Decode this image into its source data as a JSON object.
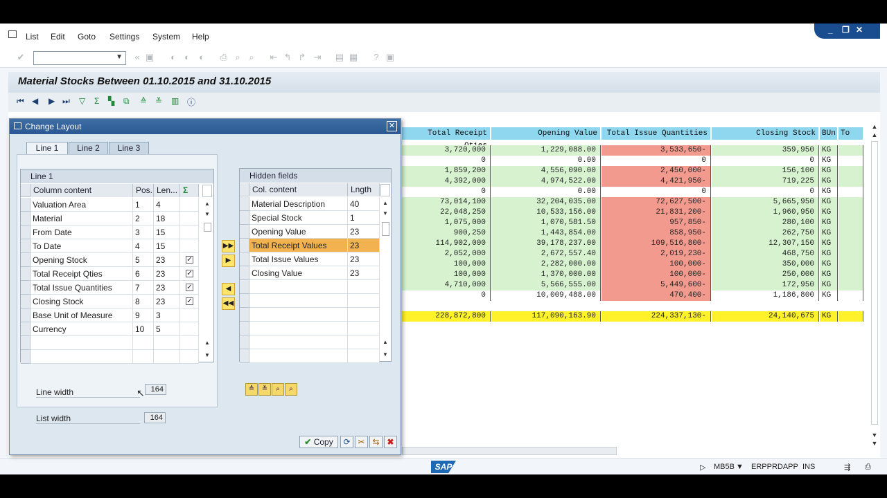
{
  "menu": [
    "List",
    "Edit",
    "Goto",
    "Settings",
    "System",
    "Help"
  ],
  "window_controls": [
    "_",
    "❐",
    "✕"
  ],
  "report": {
    "title": "Material Stocks Between 01.10.2015 and 31.10.2015",
    "headers": [
      "Total Receipt Qties",
      "Opening Value",
      "Total Issue Quantities",
      "Closing Stock",
      "BUn",
      "To"
    ],
    "rows": [
      {
        "receipt": "3,720,000",
        "opening": "1,229,088.00",
        "issue": "3,533,650-",
        "closing": "359,950",
        "bun": "KG",
        "style": "g"
      },
      {
        "receipt": "0",
        "opening": "0.00",
        "issue": "0",
        "closing": "0",
        "bun": "KG",
        "style": "w"
      },
      {
        "receipt": "1,859,200",
        "opening": "4,556,090.00",
        "issue": "2,450,000-",
        "closing": "156,100",
        "bun": "KG",
        "style": "g"
      },
      {
        "receipt": "4,392,000",
        "opening": "4,974,522.00",
        "issue": "4,421,950-",
        "closing": "719,225",
        "bun": "KG",
        "style": "g"
      },
      {
        "receipt": "0",
        "opening": "0.00",
        "issue": "0",
        "closing": "0",
        "bun": "KG",
        "style": "w"
      },
      {
        "receipt": "73,014,100",
        "opening": "32,204,035.00",
        "issue": "72,627,500-",
        "closing": "5,665,950",
        "bun": "KG",
        "style": "g"
      },
      {
        "receipt": "22,048,250",
        "opening": "10,533,156.00",
        "issue": "21,831,200-",
        "closing": "1,960,950",
        "bun": "KG",
        "style": "g"
      },
      {
        "receipt": "1,075,000",
        "opening": "1,070,581.50",
        "issue": "957,850-",
        "closing": "280,100",
        "bun": "KG",
        "style": "g"
      },
      {
        "receipt": "900,250",
        "opening": "1,443,854.00",
        "issue": "858,950-",
        "closing": "262,750",
        "bun": "KG",
        "style": "g"
      },
      {
        "receipt": "114,902,000",
        "opening": "39,178,237.00",
        "issue": "109,516,800-",
        "closing": "12,307,150",
        "bun": "KG",
        "style": "g"
      },
      {
        "receipt": "2,052,000",
        "opening": "2,672,557.40",
        "issue": "2,019,230-",
        "closing": "468,750",
        "bun": "KG",
        "style": "g"
      },
      {
        "receipt": "100,000",
        "opening": "2,282,000.00",
        "issue": "100,000-",
        "closing": "350,000",
        "bun": "KG",
        "style": "g"
      },
      {
        "receipt": "100,000",
        "opening": "1,370,000.00",
        "issue": "100,000-",
        "closing": "250,000",
        "bun": "KG",
        "style": "g"
      },
      {
        "receipt": "4,710,000",
        "opening": "5,566,555.00",
        "issue": "5,449,600-",
        "closing": "172,950",
        "bun": "KG",
        "style": "g"
      },
      {
        "receipt": "0",
        "opening": "10,009,488.00",
        "issue": "470,400-",
        "closing": "1,186,800",
        "bun": "KG",
        "style": "w"
      }
    ],
    "total": {
      "receipt": "228,872,800",
      "opening": "117,090,163.90",
      "issue": "224,337,130-",
      "closing": "24,140,675",
      "bun": "KG"
    }
  },
  "dialog": {
    "title": "Change Layout",
    "tabs": [
      "Line 1",
      "Line 2",
      "Line 3"
    ],
    "left_table": {
      "title": "Line 1",
      "headers": [
        "Column content",
        "Pos.",
        "Len..."
      ],
      "rows": [
        {
          "content": "Valuation Area",
          "pos": "1",
          "len": "4",
          "sum": false
        },
        {
          "content": "Material",
          "pos": "2",
          "len": "18",
          "sum": false
        },
        {
          "content": "From Date",
          "pos": "3",
          "len": "15",
          "sum": false
        },
        {
          "content": "To Date",
          "pos": "4",
          "len": "15",
          "sum": false
        },
        {
          "content": "Opening Stock",
          "pos": "5",
          "len": "23",
          "sum": true
        },
        {
          "content": "Total Receipt Qties",
          "pos": "6",
          "len": "23",
          "sum": true
        },
        {
          "content": "Total Issue Quantities",
          "pos": "7",
          "len": "23",
          "sum": true
        },
        {
          "content": "Closing Stock",
          "pos": "8",
          "len": "23",
          "sum": true
        },
        {
          "content": "Base Unit of Measure",
          "pos": "9",
          "len": "3",
          "sum": false
        },
        {
          "content": "Currency",
          "pos": "10",
          "len": "5",
          "sum": false
        }
      ]
    },
    "right_table": {
      "title": "Hidden fields",
      "headers": [
        "Col. content",
        "Lngth"
      ],
      "rows": [
        {
          "content": "Material Description",
          "len": "40"
        },
        {
          "content": "Special Stock",
          "len": "1"
        },
        {
          "content": "Opening Value",
          "len": "23"
        },
        {
          "content": "Total Receipt Values",
          "len": "23"
        },
        {
          "content": "Total Issue Values",
          "len": "23"
        },
        {
          "content": "Closing Value",
          "len": "23"
        }
      ]
    },
    "line_width_label": "Line width",
    "line_width_value": "164",
    "list_width_label": "List width",
    "list_width_value": "164",
    "copy_label": "Copy"
  },
  "status": {
    "sap_logo": "SAP",
    "transaction": "MB5B",
    "server": "ERPPRDAPP",
    "mode": "INS"
  }
}
